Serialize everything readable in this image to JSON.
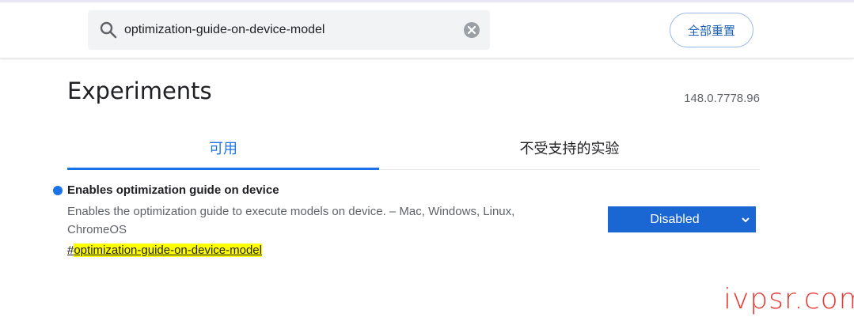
{
  "search": {
    "value": "optimization-guide-on-device-model",
    "icon": "search-icon",
    "clear_icon": "close-icon"
  },
  "header": {
    "reset_label": "全部重置"
  },
  "page": {
    "title": "Experiments",
    "version": "148.0.7778.96"
  },
  "tabs": [
    {
      "label": "可用",
      "selected": true
    },
    {
      "label": "不受支持的实验",
      "selected": false
    }
  ],
  "experiment": {
    "title": "Enables optimization guide on device",
    "description": "Enables the optimization guide to execute models on device. – Mac, Windows, Linux, ChromeOS",
    "link_hash": "#",
    "link_text": "optimization-guide-on-device-model",
    "selected_option": "Disabled"
  },
  "watermark": "ivpsr.com",
  "colors": {
    "accent": "#1a73e8",
    "select_bg": "#1a66d2",
    "highlight": "#ffff00",
    "watermark": "#e53935"
  }
}
